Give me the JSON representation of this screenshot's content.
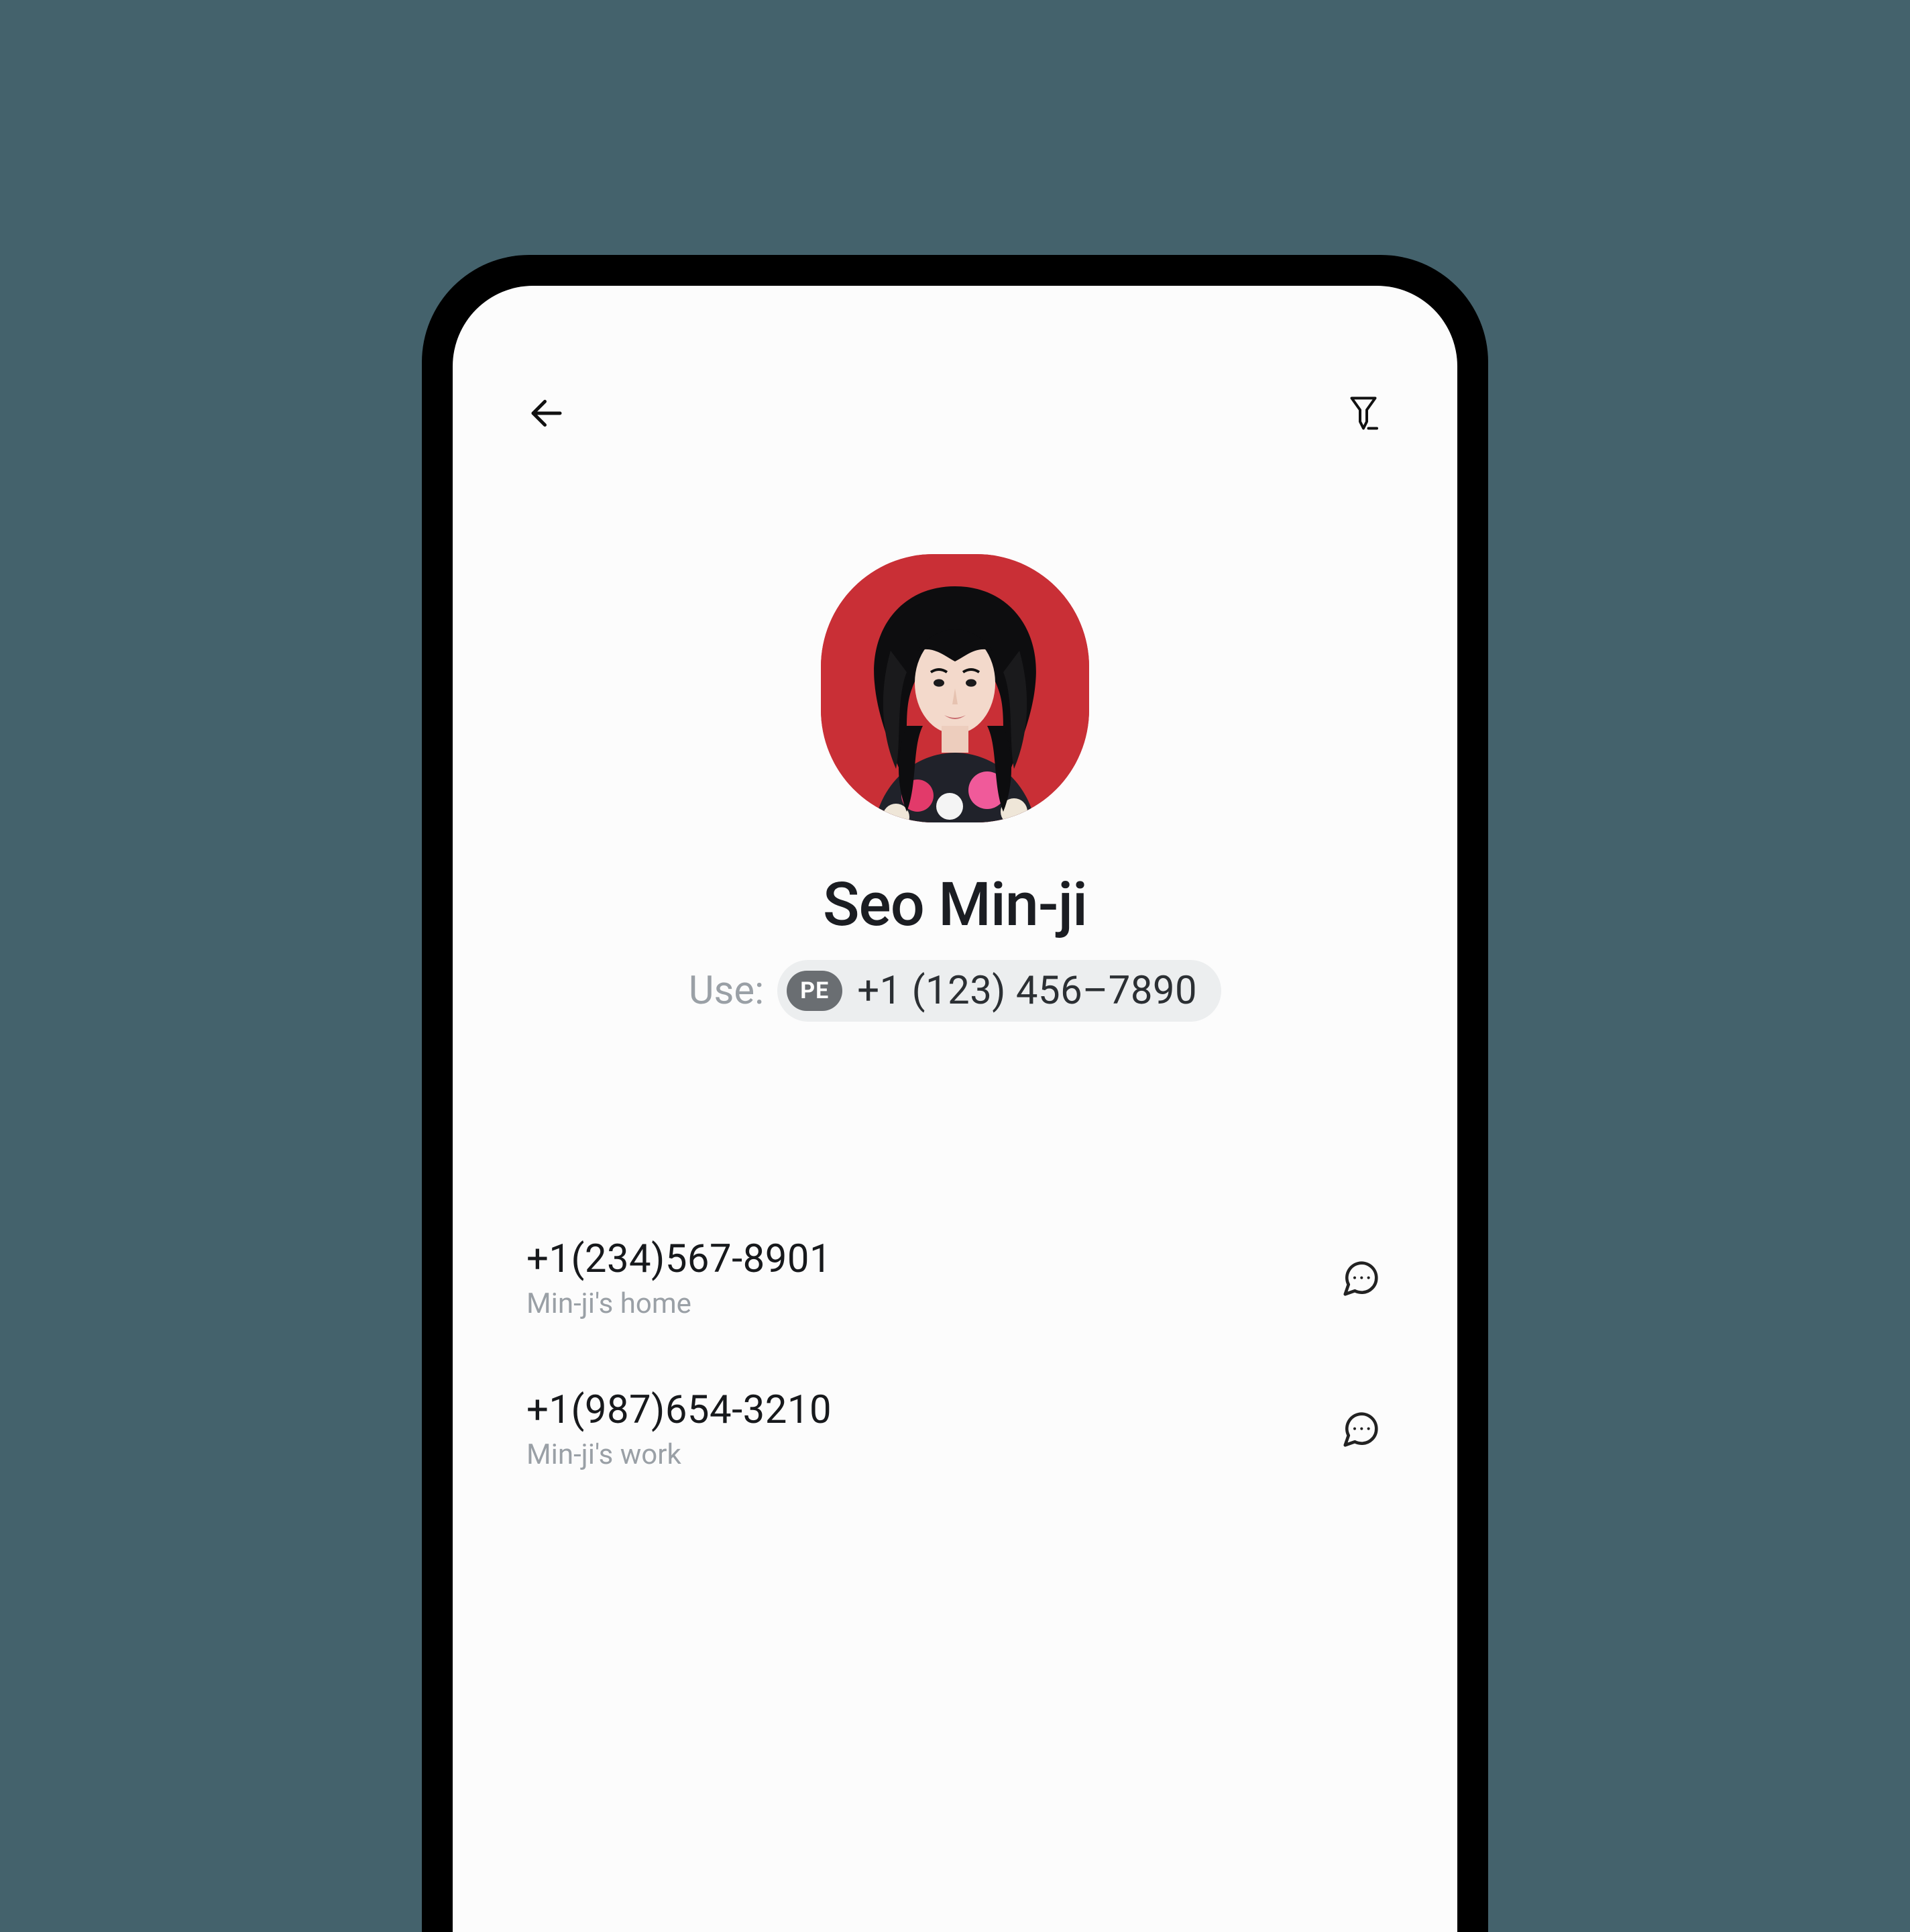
{
  "contact": {
    "name": "Seo Min-ji",
    "use_label": "Use:",
    "use_badge": "PE",
    "use_number": "+1 (123) 456–7890"
  },
  "numbers": [
    {
      "value": "+1(234)567-8901",
      "label": "Min-ji's home"
    },
    {
      "value": "+1(987)654-3210",
      "label": "Min-ji's work"
    }
  ]
}
